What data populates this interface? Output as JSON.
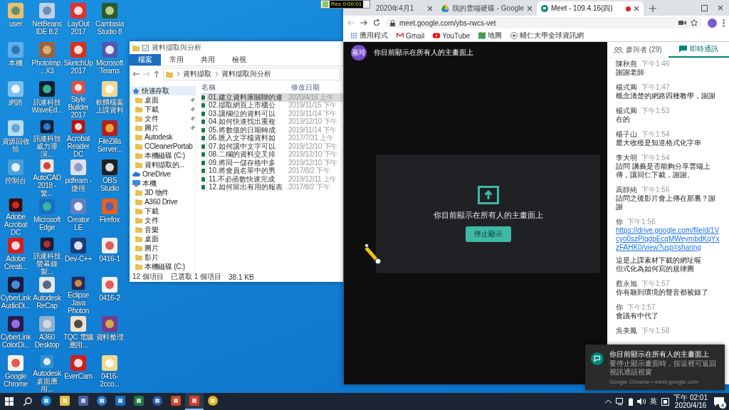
{
  "desktop_icons": [
    {
      "label": "user"
    },
    {
      "label": "本機"
    },
    {
      "label": "網路"
    },
    {
      "label": "資源回收筒"
    },
    {
      "label": "控制台"
    },
    {
      "label": "Adobe Acrobat DC"
    },
    {
      "label": "Adobe Creati..."
    },
    {
      "label": "CyberLink AudioDi..."
    },
    {
      "label": "CyberLink ColorDi..."
    },
    {
      "label": "Google Chrome"
    },
    {
      "label": "NetBeans IDE 8.2"
    },
    {
      "label": "PhotoImp... X3"
    },
    {
      "label": "訊連科技 WaveEd..."
    },
    {
      "label": "訊連科技威力導演..."
    },
    {
      "label": "AutoCAD 2018 - 繁..."
    },
    {
      "label": "Microsoft Edge"
    },
    {
      "label": "訊連科技螢幕錄製..."
    },
    {
      "label": "Autodesk ReCap"
    },
    {
      "label": "A360 Desktop"
    },
    {
      "label": "Autodesk 桌面應用..."
    },
    {
      "label": "LayOut 2017"
    },
    {
      "label": "SketchUp 2017"
    },
    {
      "label": "Style Builder 2017"
    },
    {
      "label": "Acrobat Reader DC"
    },
    {
      "label": "pdfeam - 捷徑"
    },
    {
      "label": "Creator LE"
    },
    {
      "label": "Dev-C++"
    },
    {
      "label": "Eclipse Java Photon"
    },
    {
      "label": "TQC 電腦應用..."
    },
    {
      "label": "EverCam"
    },
    {
      "label": "Camtasia Studio 8"
    },
    {
      "label": "Microsoft Teams"
    },
    {
      "label": "軟體檔案上課資料"
    },
    {
      "label": "FileZilla Server..."
    },
    {
      "label": "OBS Studio"
    },
    {
      "label": "Firefox"
    },
    {
      "label": "0416-1"
    },
    {
      "label": "0416-2"
    },
    {
      "label": "資料整理"
    },
    {
      "label": "0416-2cco..."
    }
  ],
  "explorer": {
    "title": "資料擷取與分析",
    "ribbon_tabs": [
      {
        "label": "檔案",
        "selected": true
      },
      {
        "label": "常用",
        "selected": false
      },
      {
        "label": "共用",
        "selected": false
      },
      {
        "label": "檢視",
        "selected": false
      }
    ],
    "address": [
      "資料擷取",
      "資料擷取與分析"
    ],
    "nav": [
      {
        "label": "快速存取",
        "selected": true,
        "children": [
          {
            "label": "桌面",
            "selected": false,
            "pinned": true
          },
          {
            "label": "下載",
            "selected": false,
            "pinned": true
          },
          {
            "label": "文件",
            "selected": false,
            "pinned": true
          },
          {
            "label": "圖片",
            "selected": false,
            "pinned": true
          },
          {
            "label": "Autodesk",
            "selected": false,
            "pinned": false
          },
          {
            "label": "CCleanerPortab",
            "selected": false,
            "pinned": false
          },
          {
            "label": "本機磁碟 (C:)",
            "selected": false,
            "pinned": false
          },
          {
            "label": "資料擷取的...",
            "selected": false,
            "pinned": false
          }
        ]
      },
      {
        "label": "OneDrive",
        "selected": false
      },
      {
        "label": "本機",
        "selected": false,
        "children": [
          {
            "label": "3D 物件",
            "selected": false,
            "pinned": false
          },
          {
            "label": "A360 Drive",
            "selected": false,
            "pinned": false
          },
          {
            "label": "下載",
            "selected": false,
            "pinned": false
          },
          {
            "label": "文件",
            "selected": false,
            "pinned": false
          },
          {
            "label": "音樂",
            "selected": false,
            "pinned": false
          },
          {
            "label": "桌面",
            "selected": false,
            "pinned": false
          },
          {
            "label": "圖片",
            "selected": false,
            "pinned": false
          },
          {
            "label": "影片",
            "selected": false,
            "pinned": false
          },
          {
            "label": "本機磁碟 (C:)",
            "selected": false,
            "pinned": false
          }
        ]
      }
    ],
    "columns": [
      "名稱",
      "修改日期"
    ],
    "files": [
      {
        "name": "01.建立資料庫關聯的連",
        "modified": "2020/4/16 上午",
        "selected": true
      },
      {
        "name": "02.擷取網頁上市櫃公",
        "modified": "2019/11/15 下午",
        "selected": false
      },
      {
        "name": "03.讓欄位的資料可以",
        "modified": "2019/11/14 下午",
        "selected": false
      },
      {
        "name": "04.如何快速找出重複",
        "modified": "2019/12/10 下午",
        "selected": false
      },
      {
        "name": "05.將數值的日期轉成",
        "modified": "2019/11/14 下午",
        "selected": false
      },
      {
        "name": "06.匯入文字檔資料如",
        "modified": "2017/7/31 上午",
        "selected": false
      },
      {
        "name": "07.如何讓中文字可以",
        "modified": "2019/12/10 下午",
        "selected": false
      },
      {
        "name": "08.二欄的資料交叉排",
        "modified": "2019/12/10 下午",
        "selected": false
      },
      {
        "name": "09.將同一儲存格中多",
        "modified": "2019/12/10 下午",
        "selected": false
      },
      {
        "name": "10.將會員名單中的男",
        "modified": "2017/8/2 下午",
        "selected": false
      },
      {
        "name": "11.不必函數快速完成",
        "modified": "2019/12/11 上午",
        "selected": false
      },
      {
        "name": "12.如何留出有用的報表",
        "modified": "2017/8/2 下午",
        "selected": false
      }
    ],
    "status": [
      "12 個項目",
      "已選取 1 個項目",
      "38.1 KB"
    ]
  },
  "recorder": {
    "time": "Rec 0:00:01"
  },
  "browser": {
    "tabs": [
      {
        "title": "2020年4月1",
        "selected": false,
        "recording": false
      },
      {
        "title": "我的雲端硬碟 - Google",
        "selected": false,
        "recording": false
      },
      {
        "title": "Meet - 109.4.16(四)",
        "selected": true,
        "recording": true
      }
    ],
    "url": "meet.google.com/ybs-rwcs-vet",
    "bookmarks": [
      "應用程式",
      "Gmail",
      "YouTube",
      "地圖",
      "輔仁大學全球資訊網"
    ]
  },
  "meet": {
    "presenter_initials": "嘉玲",
    "banner": "你目前顯示在所有人的主畫面上",
    "card_message": "你目前顯示在所有人的主畫面上",
    "stop_button": "停止顯示",
    "chat_tabs": [
      {
        "label": "參與者 (29)",
        "selected": false
      },
      {
        "label": "即時通訊",
        "selected": true
      }
    ],
    "messages": [
      {
        "sender": "陳秋燕",
        "time": "下午1:46",
        "lines": [
          {
            "kind": "text",
            "text": "謝謝老師"
          }
        ]
      },
      {
        "sender": "楊式興",
        "time": "下午1:47",
        "lines": [
          {
            "kind": "text",
            "text": "概念清楚的網路四種教學，謝謝"
          }
        ]
      },
      {
        "sender": "楊式興",
        "time": "下午1:53",
        "lines": [
          {
            "kind": "text",
            "text": "在的"
          }
        ]
      },
      {
        "sender": "楊子山",
        "time": "下午1:54",
        "lines": [
          {
            "kind": "text",
            "text": "最大收穫是知道格式化字串"
          }
        ]
      },
      {
        "sender": "李大明",
        "time": "下午1:54",
        "lines": [
          {
            "kind": "text",
            "text": "請問 講義是否能夠分享雲端上傳，讓同仁下載，謝謝。"
          }
        ]
      },
      {
        "sender": "高靜純",
        "time": "下午1:56",
        "lines": [
          {
            "kind": "text",
            "text": "請問之後影片會上傳在那裏？謝謝"
          }
        ]
      },
      {
        "sender": "你",
        "time": "下午1:56",
        "lines": [
          {
            "kind": "link",
            "text": "https://drive.google.com/file/d/1Vcyo0szPlqdpEcqMWeymbdKqYxzFAHK0/view?usp=sharing"
          },
          {
            "kind": "text",
            "text": "這是上課素材下載的網址喔"
          },
          {
            "kind": "text",
            "text": "但式化為如何寫的規律圖"
          }
        ]
      },
      {
        "sender": "蔡永旭",
        "time": "下午1:57",
        "lines": [
          {
            "kind": "text",
            "text": "你有聽到環境的聲音都被錄了"
          }
        ]
      },
      {
        "sender": "你",
        "time": "下午1:57",
        "lines": [
          {
            "kind": "text",
            "text": "會議有中代了"
          }
        ]
      },
      {
        "sender": "吳美鳳",
        "time": "下午1:58"
      }
    ]
  },
  "notification": {
    "title": "你目前顯示在所有人的主畫面上",
    "body": "要停止顯示畫面時，按這裡可返回視訊通話視窗",
    "source": "Google Chrome • meet.google.com"
  },
  "taskbar": {
    "apps": [
      {
        "selected": false
      },
      {
        "selected": false
      },
      {
        "selected": false
      },
      {
        "selected": false
      },
      {
        "selected": false
      },
      {
        "selected": false
      },
      {
        "selected": false
      },
      {
        "selected": false
      },
      {
        "selected": true
      },
      {
        "selected": false
      }
    ],
    "ime": "英",
    "time": "下午 02:01",
    "date": "2020/4/16",
    "notification_count": "4"
  }
}
